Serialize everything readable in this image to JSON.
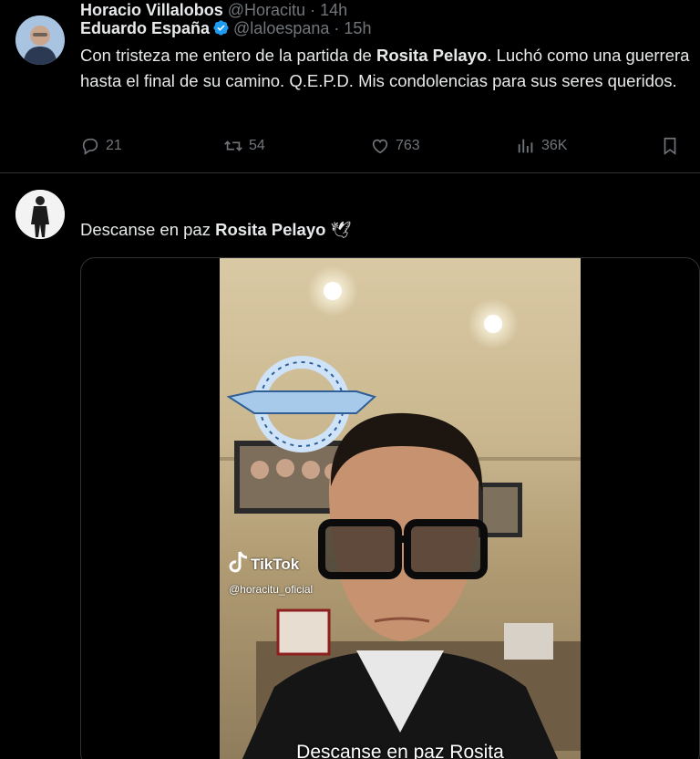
{
  "tweets": [
    {
      "author": "Eduardo España",
      "handle": "@laloespana",
      "separator": "·",
      "time": "15h",
      "verified": true,
      "text_before": "Con tristeza me entero de la partida de ",
      "text_bold": "Rosita Pelayo",
      "text_after": ". Luchó como una guerrera hasta el final de su camino. Q.E.P.D. Mis condolencias para sus seres queridos.",
      "stats": {
        "replies": "21",
        "reposts": "54",
        "likes": "763",
        "views": "36K"
      }
    },
    {
      "author": "Horacio Villalobos",
      "handle": "@Horacitu",
      "separator": "·",
      "time": "14h",
      "text_before": "Descanse en paz ",
      "text_bold": "Rosita Pelayo",
      "emoji": "🕊",
      "video": {
        "watermark_brand": "TikTok",
        "watermark_user": "@horacitu_oficial",
        "caption": "Descanse en paz Rosita"
      }
    }
  ],
  "colors": {
    "background": "#000000",
    "text": "#e7e9ea",
    "muted": "#71767b",
    "verified": "#1d9bf0",
    "border": "#2f3336"
  },
  "icons": [
    "reply-icon",
    "repost-icon",
    "like-icon",
    "views-icon",
    "bookmark-icon",
    "verified-badge-icon",
    "tiktok-logo-icon"
  ]
}
